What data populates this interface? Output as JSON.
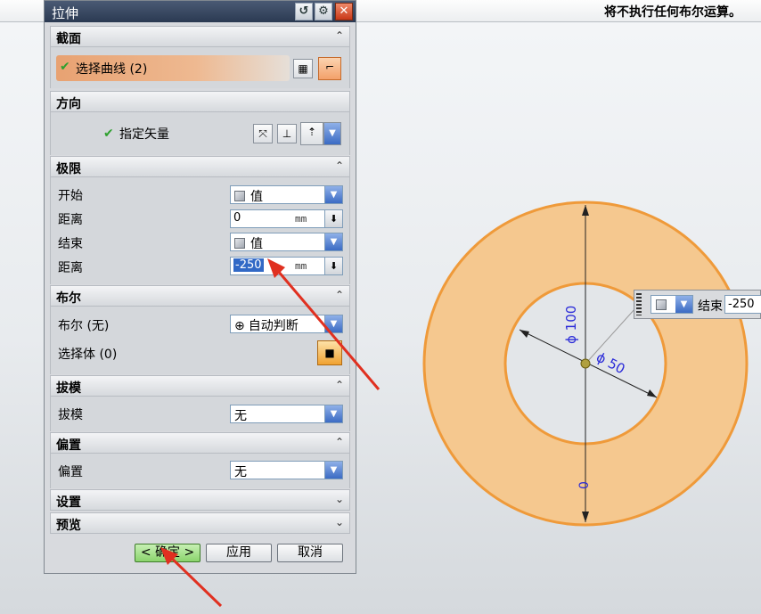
{
  "status_message": "将不执行任何布尔运算。",
  "dialog": {
    "title": "拉伸",
    "title_buttons": {
      "reset": "↺",
      "settings": "⚙",
      "close": "✕"
    }
  },
  "sections": {
    "section": {
      "header": "截面",
      "row_label": "选择曲线 (2)"
    },
    "direction": {
      "header": "方向",
      "row_label": "指定矢量"
    },
    "limits": {
      "header": "极限",
      "start_label": "开始",
      "start_value": "值",
      "start_distance_label": "距离",
      "start_distance": "0",
      "end_label": "结束",
      "end_value": "值",
      "end_distance_label": "距离",
      "end_distance": "-250",
      "unit": "mm"
    },
    "boolean": {
      "header": "布尔",
      "bool_label": "布尔 (无)",
      "bool_value": "自动判断",
      "select_body_label": "选择体 (0)"
    },
    "draft": {
      "header": "拔模",
      "label": "拔模",
      "value": "无"
    },
    "offset": {
      "header": "偏置",
      "label": "偏置",
      "value": "无"
    },
    "settings": {
      "header": "设置"
    },
    "preview": {
      "header": "预览"
    }
  },
  "footer": {
    "ok": "< 确定 >",
    "apply": "应用",
    "cancel": "取消"
  },
  "viewport": {
    "dim_outer": "ϕ 100",
    "dim_inner": "ϕ 50",
    "dim_zero": "0",
    "float_label": "结束",
    "float_value": "-250"
  },
  "colors": {
    "ring_fill": "#f5c88f",
    "ring_edge": "#ef9a3a",
    "dimension_blue": "#2a2ad8",
    "annotation_red": "#e03020"
  }
}
